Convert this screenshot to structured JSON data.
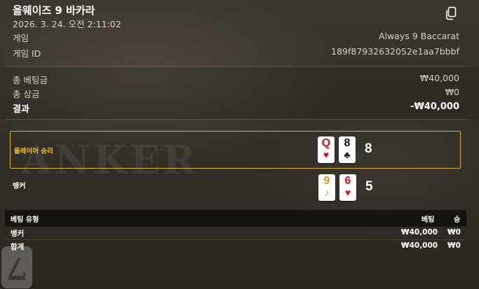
{
  "header": {
    "title": "올웨이즈 9 바카라",
    "datetime": "2026. 3. 24. 오전 2:11:02",
    "copy_icon": "copy-icon"
  },
  "info": {
    "game_label": "게임",
    "game_value": "Always 9 Baccarat",
    "game_id_label": "게임 ID",
    "game_id_value": "189f87932632052e1aa7bbbf"
  },
  "summary": {
    "total_bet_label": "총 베팅금",
    "total_bet_value": "₩40,000",
    "total_win_label": "총 상금",
    "total_win_value": "₩0",
    "result_label": "결과",
    "result_value": "-₩40,000"
  },
  "hands": {
    "player": {
      "label": "플레이어 승리",
      "cards": [
        {
          "rank": "Q",
          "suit": "♥",
          "color": "red"
        },
        {
          "rank": "8",
          "suit": "♣",
          "color": "black"
        }
      ],
      "score": "8"
    },
    "banker": {
      "label": "뱅커",
      "cards": [
        {
          "rank": "9",
          "suit": "♪",
          "color": "gold"
        },
        {
          "rank": "6",
          "suit": "♥",
          "color": "red"
        }
      ],
      "score": "5"
    }
  },
  "bets_table": {
    "headers": [
      "베팅 유형",
      "베팅",
      "승"
    ],
    "rows": [
      {
        "type": "뱅커",
        "bet": "₩40,000",
        "win": "₩0"
      },
      {
        "type": "합계",
        "bet": "₩40,000",
        "win": "₩0"
      }
    ]
  },
  "background": {
    "table_text": "ANKER",
    "card_rank": "7"
  },
  "colors": {
    "winner_border": "#d8b52a",
    "winner_label": "#f0c419",
    "red_suit": "#d4121c"
  }
}
